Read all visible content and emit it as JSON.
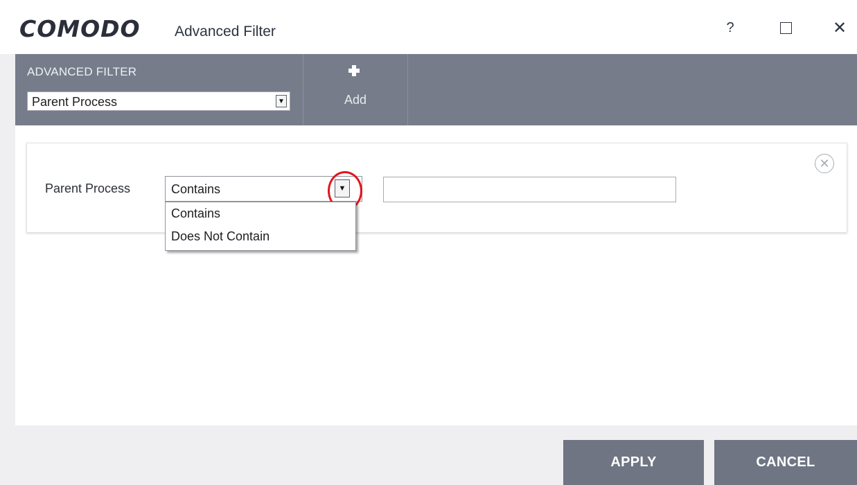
{
  "window": {
    "logo": "COMODO",
    "title": "Advanced Filter",
    "controls": {
      "help": "?",
      "maximize": "☐",
      "close": "✕"
    }
  },
  "toolbar": {
    "section_label": "ADVANCED FILTER",
    "filter_select_value": "Parent Process",
    "add_label": "Add"
  },
  "filter_row": {
    "label": "Parent Process",
    "condition_value": "Contains",
    "text_value": "",
    "condition_options": [
      "Contains",
      "Does Not Contain"
    ]
  },
  "buttons": {
    "apply": "APPLY",
    "cancel": "CANCEL"
  },
  "icons": {
    "add": "plus-icon",
    "remove": "close-circle-icon",
    "dropdown": "triangle-down-icon"
  },
  "colors": {
    "toolbar_bg": "#767c8a",
    "button_bg": "#6f7583",
    "highlight": "#e0161f"
  }
}
